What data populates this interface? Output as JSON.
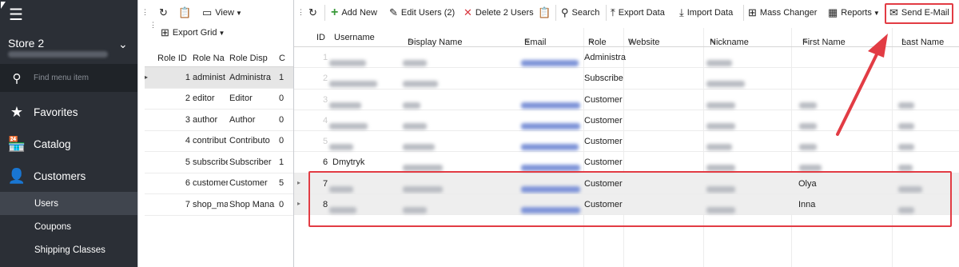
{
  "sidebar": {
    "store_name": "Store 2",
    "search_placeholder": "Find menu item",
    "nav": [
      {
        "label": "Favorites"
      },
      {
        "label": "Catalog"
      },
      {
        "label": "Customers"
      }
    ],
    "sub": [
      {
        "label": "Users"
      },
      {
        "label": "Coupons"
      },
      {
        "label": "Shipping Classes"
      }
    ]
  },
  "roles_toolbar": {
    "view_label": "View",
    "export_label": "Export Grid"
  },
  "roles_table": {
    "columns": [
      "Role ID",
      "Role Na",
      "Role Disp",
      "C"
    ],
    "rows": [
      {
        "id": "1",
        "name": "administ",
        "display": "Administra",
        "c": "1"
      },
      {
        "id": "2",
        "name": "editor",
        "display": "Editor",
        "c": "0"
      },
      {
        "id": "3",
        "name": "author",
        "display": "Author",
        "c": "0"
      },
      {
        "id": "4",
        "name": "contribut",
        "display": "Contributo",
        "c": "0"
      },
      {
        "id": "5",
        "name": "subscribe",
        "display": "Subscriber",
        "c": "1"
      },
      {
        "id": "6",
        "name": "customer",
        "display": "Customer",
        "c": "5"
      },
      {
        "id": "7",
        "name": "shop_ma",
        "display": "Shop Mana",
        "c": "0"
      }
    ]
  },
  "toolbar": {
    "add_new": "Add New",
    "edit_users": "Edit Users (2)",
    "delete_users": "Delete 2 Users",
    "search": "Search",
    "export_data": "Export Data",
    "import_data": "Import Data",
    "mass_changer": "Mass Changer",
    "reports": "Reports",
    "send_email": "Send E-Mail"
  },
  "users_table": {
    "columns": [
      "ID",
      "Username",
      "Display Name",
      "Email",
      "Role",
      "Website",
      "Nickname",
      "First Name",
      "Last Name"
    ],
    "rows": [
      {
        "id": "1",
        "role": "Administra",
        "first": ""
      },
      {
        "id": "2",
        "role": "Subscribe",
        "first": ""
      },
      {
        "id": "3",
        "role": "Customer",
        "first": ""
      },
      {
        "id": "4",
        "role": "Customer",
        "first": ""
      },
      {
        "id": "5",
        "role": "Customer",
        "first": ""
      },
      {
        "id": "6",
        "username": "Dmytryk",
        "role": "Customer",
        "first": ""
      },
      {
        "id": "7",
        "role": "Customer",
        "first": "Olya"
      },
      {
        "id": "8",
        "role": "Customer",
        "first": "Inna"
      }
    ]
  },
  "colors": {
    "sidebar_bg": "#2b2f36",
    "highlight": "#e23c44",
    "accent_green": "#3a9a3a",
    "delete_red": "#d9363e"
  }
}
